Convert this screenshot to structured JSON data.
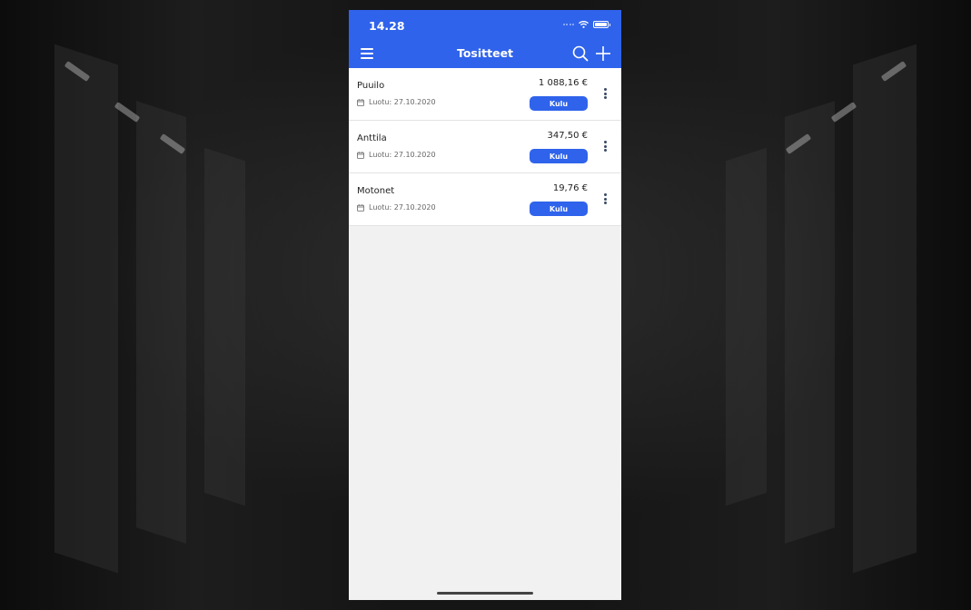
{
  "status_bar": {
    "time": "14.28"
  },
  "header": {
    "title": "Tositteet"
  },
  "icons": {
    "menu": "hamburger-menu-icon",
    "search": "search-icon",
    "add": "plus-icon",
    "calendar": "calendar-icon",
    "more": "vertical-dots-icon"
  },
  "colors": {
    "accent": "#2f63eb",
    "background": "#f1f1f1"
  },
  "items": [
    {
      "name": "Puuilo",
      "date": "Luotu: 27.10.2020",
      "amount": "1 088,16 €",
      "type": "Kulu"
    },
    {
      "name": "Anttila",
      "date": "Luotu: 27.10.2020",
      "amount": "347,50 €",
      "type": "Kulu"
    },
    {
      "name": "Motonet",
      "date": "Luotu: 27.10.2020",
      "amount": "19,76 €",
      "type": "Kulu"
    }
  ]
}
